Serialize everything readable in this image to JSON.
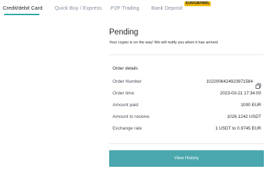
{
  "tabs": [
    {
      "label": "Credit/debit Card",
      "active": true
    },
    {
      "label": "Quick Buy / Express",
      "active": false
    },
    {
      "label": "P2P Trading",
      "active": false
    },
    {
      "label": "Bank Deposit",
      "active": false
    }
  ],
  "bank_badge": "EUR/GBP/BRL",
  "status": {
    "title": "Pending",
    "message": "Your crypto is on the way! We will notify you when it has arrived."
  },
  "order": {
    "header": "Order details",
    "rows": [
      {
        "label": "Order Number",
        "value": "1022006424923971584"
      },
      {
        "label": "Order time",
        "value": "2023-03-21 17:34:00"
      },
      {
        "label": "Amount paid",
        "value": "1000 EUR"
      },
      {
        "label": "Amount to receive",
        "value": "1026.1242 USDT"
      },
      {
        "label": "Exchange rate",
        "value": "1 USDT to 0.9745 EUR"
      }
    ]
  },
  "actions": {
    "view_history": "View History"
  },
  "colors": {
    "accent": "#4aa7ad",
    "tab_underline": "#2aa6a6",
    "badge": "#f0b90b"
  }
}
